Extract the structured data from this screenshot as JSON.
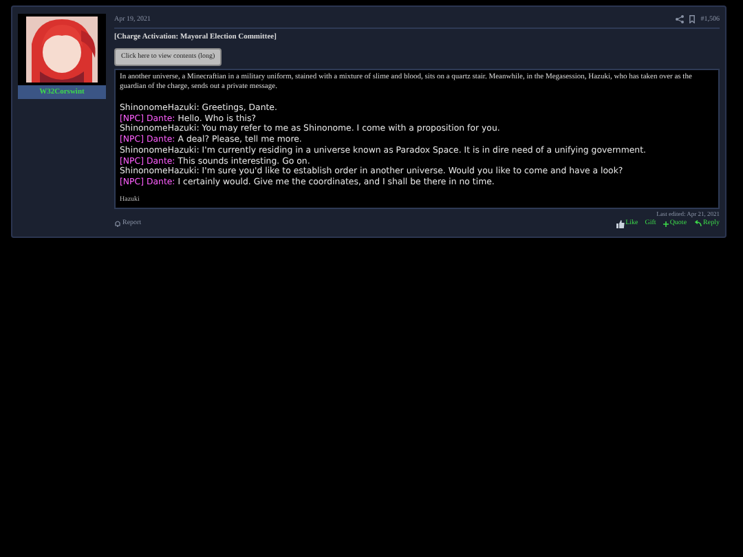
{
  "post": {
    "author": "W32Corswint",
    "date": "Apr 19, 2021",
    "post_number": "#1,506",
    "title": "[Charge Activation: Mayoral Election Committee]",
    "spoiler_button": "Click here to view contents (long)",
    "narration": "In another universe, a Minecraftian in a military uniform, stained with a mixture of slime and blood, sits on a quartz stair. Meanwhile, in the Megasession, Hazuki, who has taken over as the guardian of the charge, sends out a private message.",
    "chat": [
      {
        "kind": "player",
        "speaker": "ShinonomeHazuki:",
        "text": "Greetings, Dante."
      },
      {
        "kind": "npc",
        "speaker": "[NPC] Dante:",
        "text": "Hello. Who is this?"
      },
      {
        "kind": "player",
        "speaker": "ShinonomeHazuki:",
        "text": "You may refer to me as Shinonome. I come with a proposition for you."
      },
      {
        "kind": "npc",
        "speaker": "[NPC] Dante:",
        "text": "A deal? Please, tell me more."
      },
      {
        "kind": "player",
        "speaker": "ShinonomeHazuki:",
        "text": "I'm currently residing in a universe known as Paradox Space. It is in dire need of a unifying government."
      },
      {
        "kind": "npc",
        "speaker": "[NPC] Dante:",
        "text": "This sounds interesting. Go on."
      },
      {
        "kind": "player",
        "speaker": "ShinonomeHazuki:",
        "text": "I'm sure you'd like to establish order in another universe. Would you like to come and have a look?"
      },
      {
        "kind": "npc",
        "speaker": "[NPC] Dante:",
        "text": "I certainly would. Give me the coordinates, and I shall be there in no time."
      }
    ],
    "signature": "Hazuki",
    "last_edited": "Last edited: Apr 21, 2021",
    "report": "Report",
    "actions": [
      {
        "kind": "like",
        "label": "Like"
      },
      {
        "kind": "plain",
        "label": "Gift"
      },
      {
        "kind": "quote",
        "label": "Quote"
      },
      {
        "kind": "reply",
        "label": "Reply"
      }
    ]
  }
}
